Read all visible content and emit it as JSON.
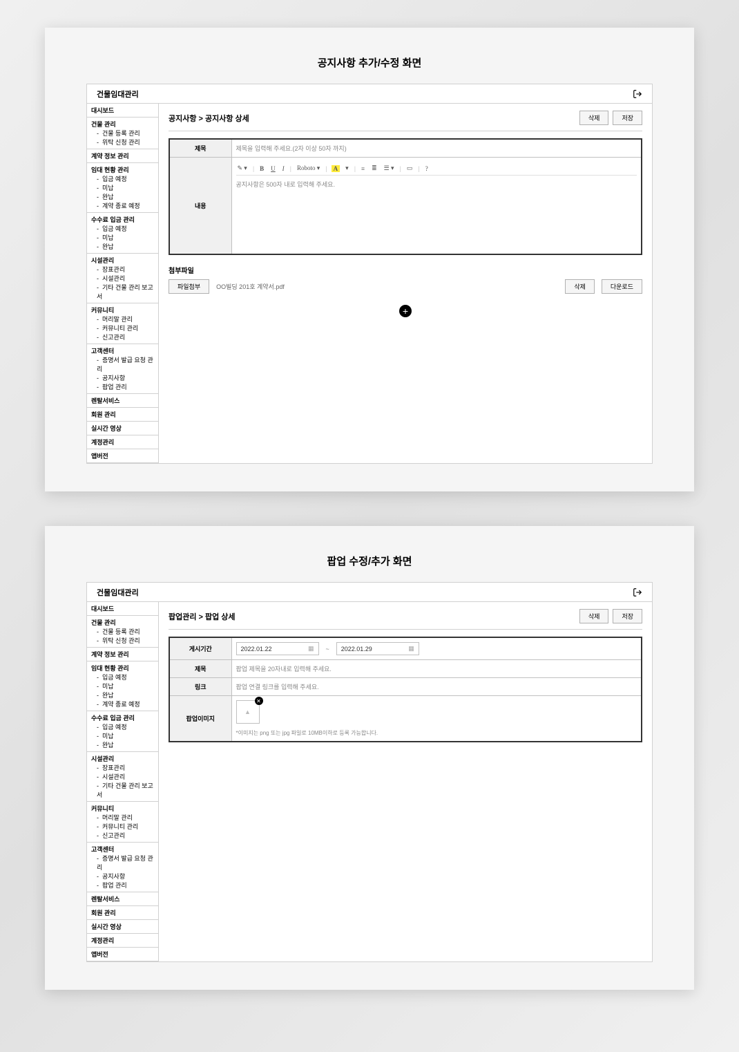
{
  "screen1": {
    "title": "공지사항 추가/수정 화면",
    "brand": "건물임대관리",
    "breadcrumb": "공지사항 > 공지사항 상세",
    "btn_delete": "삭제",
    "btn_save": "저장",
    "field_title_label": "제목",
    "field_title_placeholder": "제목을 입력해 주세요.(2자 이상 50자 까지)",
    "field_content_label": "내용",
    "field_content_placeholder": "공지사항은 500자 내로 입력해 주세요.",
    "editor_font": "Roboto",
    "attachment_section": "첨부파일",
    "btn_attach": "파일첨부",
    "filename": "OO빌딩 201호 계약서.pdf",
    "btn_attach_delete": "삭제",
    "btn_download": "다운로드"
  },
  "screen2": {
    "title": "팝업 수정/추가 화면",
    "brand": "건물임대관리",
    "breadcrumb": "팝업관리 > 팝업 상세",
    "btn_delete": "삭제",
    "btn_save": "저장",
    "field_period_label": "게시기간",
    "date_from": "2022.01.22",
    "date_to": "2022.01.29",
    "date_tilde": "~",
    "field_title_label": "제목",
    "field_title_placeholder": "팝업 제목을 20자내로 입력해 주세요.",
    "field_link_label": "링크",
    "field_link_placeholder": "팝업 연결 링크를 입력해 주세요.",
    "field_image_label": "팝업이미지",
    "image_hint": "*이미지는 png 또는 jpg 파일로 10MB이하로 등록 가능합니다."
  },
  "sidebar": {
    "dashboard": "대시보드",
    "building_mgmt": "건물 관리",
    "building_sub1": "건물 등록 관리",
    "building_sub2": "위탁 신청 관리",
    "contract_info": "계약 정보 관리",
    "rent_status": "임대 현황 관리",
    "rent_sub1": "입금 예정",
    "rent_sub2": "미납",
    "rent_sub3": "완납",
    "rent_sub4": "계약 종료 예정",
    "fee_mgmt": "수수료 입금 관리",
    "fee_sub1": "입금 예정",
    "fee_sub2": "미납",
    "fee_sub3": "완납",
    "facility": "시설관리",
    "fac_sub1": "장표관리",
    "fac_sub2": "시설관리",
    "fac_sub3": "기타 건물 관리 보고서",
    "community": "커뮤니티",
    "com_sub1": "머리말 관리",
    "com_sub2": "커뮤니티 관리",
    "com_sub3": "신고관리",
    "customer": "고객센터",
    "cust_sub1": "증명서 발급 요청 관리",
    "cust_sub2": "공지사항",
    "cust_sub3": "팝업 관리",
    "rental_service": "렌탈서비스",
    "member_mgmt": "회원 관리",
    "live_video": "실시간 영상",
    "account_mgmt": "계정관리",
    "app_version": "앱버전"
  }
}
